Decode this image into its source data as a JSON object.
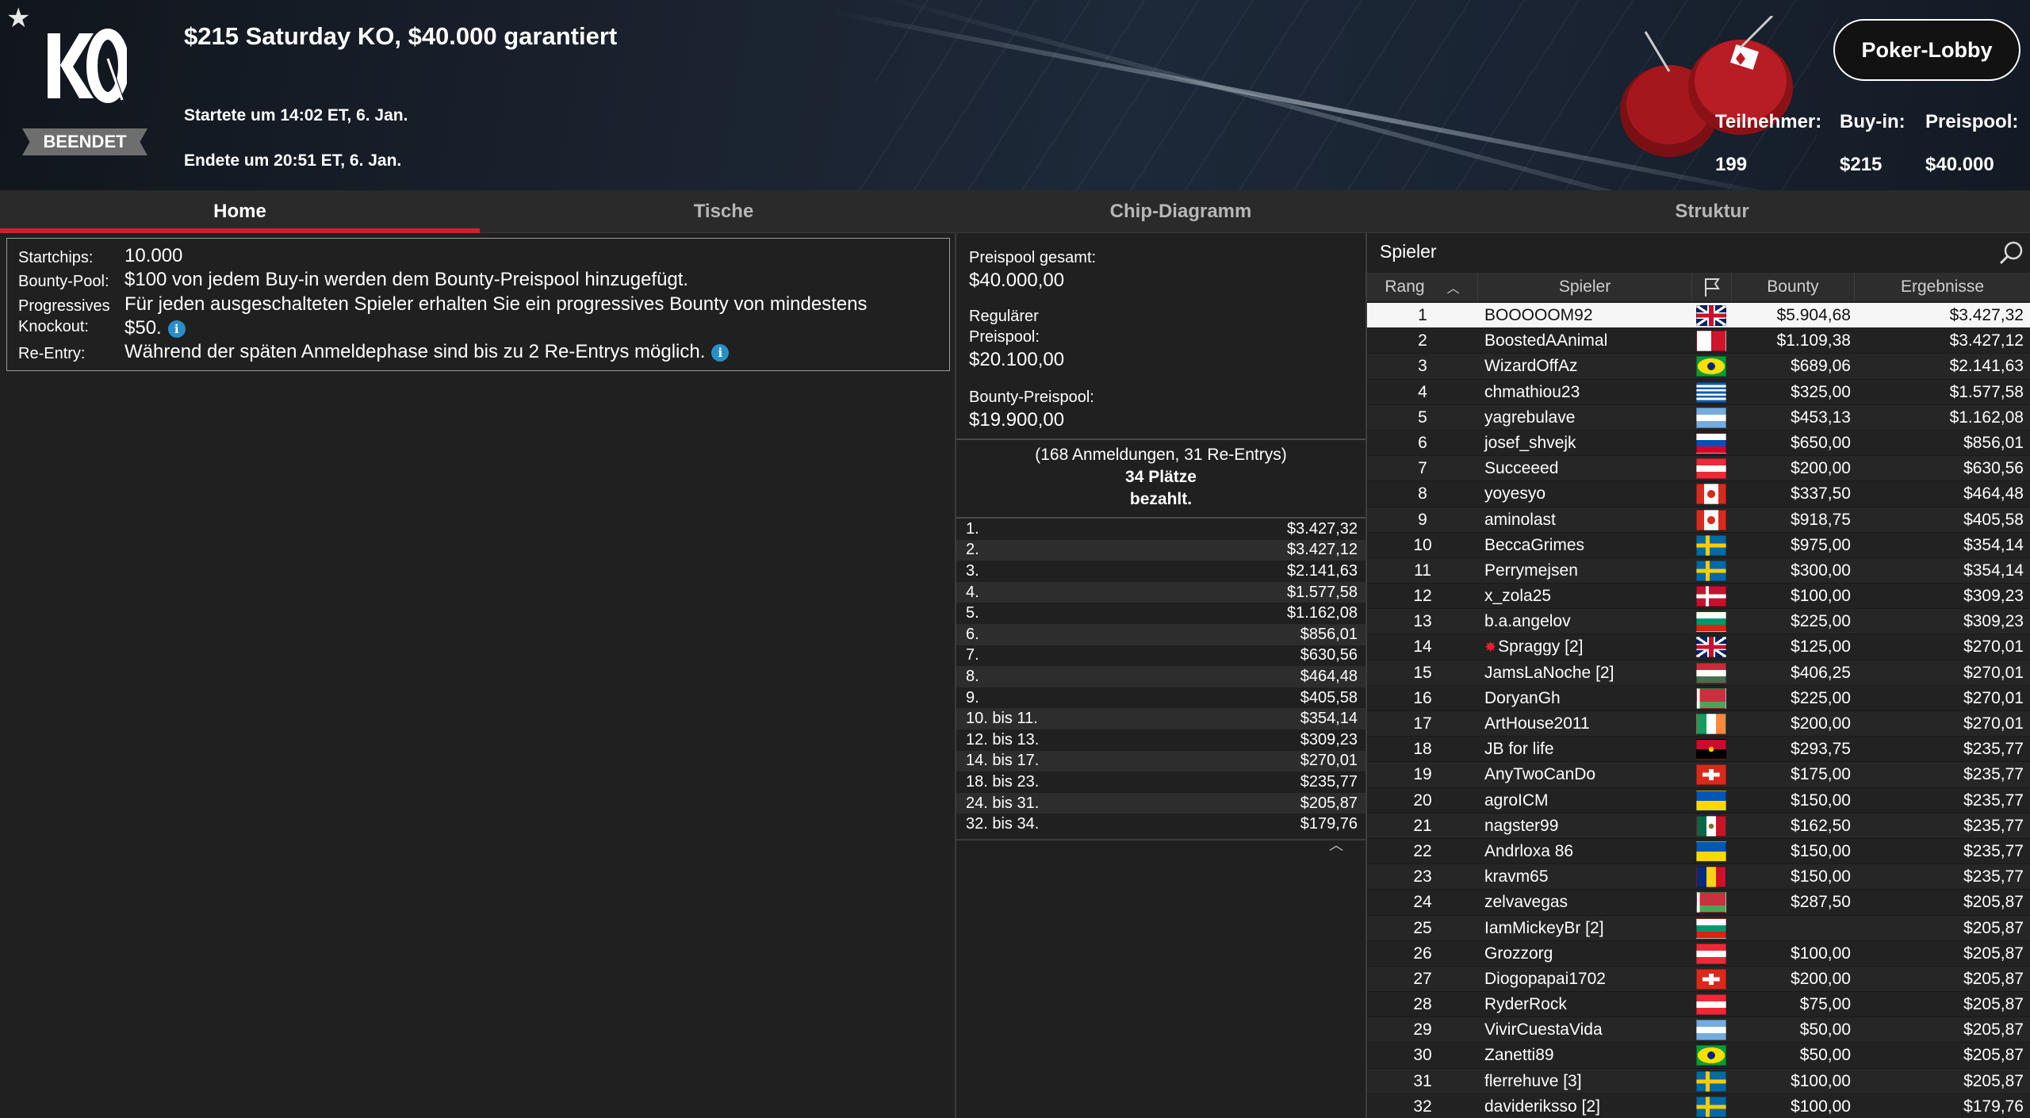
{
  "header": {
    "title": "$215 Saturday KO, $40.000 garantiert",
    "logo_text": "KO",
    "status_badge": "BEENDET",
    "started": "Startete um 14:02 ET, 6. Jan.",
    "ended": "Endete um 20:51 ET, 6. Jan.",
    "lobby_button": "Poker-Lobby",
    "stats": [
      {
        "label": "Teilnehmer:",
        "value": "199"
      },
      {
        "label": "Buy-in:",
        "value": "$215"
      },
      {
        "label": "Preispool:",
        "value": "$40.000"
      }
    ]
  },
  "tabs": [
    {
      "label": "Home",
      "active": true
    },
    {
      "label": "Tische",
      "active": false
    },
    {
      "label": "Chip-Diagramm",
      "active": false
    },
    {
      "label": "Struktur",
      "active": false
    }
  ],
  "details": {
    "startchips_label": "Startchips:",
    "startchips": "10.000",
    "bounty_pool_label": "Bounty-Pool:",
    "bounty_pool": "$100 von jedem Buy-in werden dem Bounty-Preispool hinzugefügt.",
    "progressive_label_1": "Progressives",
    "progressive_label_2": "Knockout:",
    "progressive_line1": "Für jeden ausgeschalteten Spieler erhalten Sie ein progressives Bounty von mindestens",
    "progressive_line2": "$50.",
    "reentry_label": "Re-Entry:",
    "reentry": "Während der späten Anmeldephase sind bis zu 2 Re-Entrys möglich."
  },
  "prizepool": {
    "total_label": "Preispool gesamt:",
    "total": "$40.000,00",
    "regular_label_1": "Regulärer",
    "regular_label_2": "Preispool:",
    "regular": "$20.100,00",
    "bounty_label": "Bounty-Preispool:",
    "bounty": "$19.900,00",
    "entries": "(168 Anmeldungen, 31 Re-Entrys)",
    "paid_1": "34 Plätze",
    "paid_2": "bezahlt.",
    "payouts": [
      {
        "place": "1.",
        "amount": "$3.427,32"
      },
      {
        "place": "2.",
        "amount": "$3.427,12"
      },
      {
        "place": "3.",
        "amount": "$2.141,63"
      },
      {
        "place": "4.",
        "amount": "$1.577,58"
      },
      {
        "place": "5.",
        "amount": "$1.162,08"
      },
      {
        "place": "6.",
        "amount": "$856,01"
      },
      {
        "place": "7.",
        "amount": "$630,56"
      },
      {
        "place": "8.",
        "amount": "$464,48"
      },
      {
        "place": "9.",
        "amount": "$405,58"
      },
      {
        "place": "10. bis 11.",
        "amount": "$354,14"
      },
      {
        "place": "12. bis 13.",
        "amount": "$309,23"
      },
      {
        "place": "14. bis 17.",
        "amount": "$270,01"
      },
      {
        "place": "18. bis 23.",
        "amount": "$235,77"
      },
      {
        "place": "24. bis 31.",
        "amount": "$205,87"
      },
      {
        "place": "32. bis 34.",
        "amount": "$179,76"
      }
    ]
  },
  "players": {
    "title": "Spieler",
    "columns": {
      "rank": "Rang",
      "player": "Spieler",
      "bounty": "Bounty",
      "result": "Ergebnisse"
    },
    "rows": [
      {
        "rank": "1",
        "name": "BOOOOOM92",
        "flag": "gb",
        "bounty": "$5.904,68",
        "result": "$3.427,32",
        "selected": true
      },
      {
        "rank": "2",
        "name": "BoostedAAnimal",
        "flag": "mt",
        "bounty": "$1.109,38",
        "result": "$3.427,12"
      },
      {
        "rank": "3",
        "name": "WizardOffAz",
        "flag": "br",
        "bounty": "$689,06",
        "result": "$2.141,63"
      },
      {
        "rank": "4",
        "name": "chmathiou23",
        "flag": "gr",
        "bounty": "$325,00",
        "result": "$1.577,58"
      },
      {
        "rank": "5",
        "name": "yagrebulave",
        "flag": "ar",
        "bounty": "$453,13",
        "result": "$1.162,08"
      },
      {
        "rank": "6",
        "name": "josef_shvejk",
        "flag": "si",
        "bounty": "$650,00",
        "result": "$856,01"
      },
      {
        "rank": "7",
        "name": "Succeeed",
        "flag": "at",
        "bounty": "$200,00",
        "result": "$630,56"
      },
      {
        "rank": "8",
        "name": "yoyesyo",
        "flag": "ca",
        "bounty": "$337,50",
        "result": "$464,48"
      },
      {
        "rank": "9",
        "name": "aminolast",
        "flag": "ca",
        "bounty": "$918,75",
        "result": "$405,58"
      },
      {
        "rank": "10",
        "name": "BeccaGrimes",
        "flag": "se",
        "bounty": "$975,00",
        "result": "$354,14"
      },
      {
        "rank": "11",
        "name": "Perrymejsen",
        "flag": "se",
        "bounty": "$300,00",
        "result": "$354,14"
      },
      {
        "rank": "12",
        "name": "x_zola25",
        "flag": "dk",
        "bounty": "$100,00",
        "result": "$309,23"
      },
      {
        "rank": "13",
        "name": "b.a.angelov",
        "flag": "bg",
        "bounty": "$225,00",
        "result": "$309,23"
      },
      {
        "rank": "14",
        "name": "Spraggy [2]",
        "flag": "gb",
        "bounty": "$125,00",
        "result": "$270,01",
        "star": true
      },
      {
        "rank": "15",
        "name": "JamsLaNoche [2]",
        "flag": "hu",
        "bounty": "$406,25",
        "result": "$270,01"
      },
      {
        "rank": "16",
        "name": "DoryanGh",
        "flag": "by",
        "bounty": "$225,00",
        "result": "$270,01"
      },
      {
        "rank": "17",
        "name": "ArtHouse2011",
        "flag": "ie",
        "bounty": "$200,00",
        "result": "$270,01"
      },
      {
        "rank": "18",
        "name": "JB for life",
        "flag": "ao",
        "bounty": "$293,75",
        "result": "$235,77"
      },
      {
        "rank": "19",
        "name": "AnyTwoCanDo",
        "flag": "ch",
        "bounty": "$175,00",
        "result": "$235,77"
      },
      {
        "rank": "20",
        "name": "agroICM",
        "flag": "ua",
        "bounty": "$150,00",
        "result": "$235,77"
      },
      {
        "rank": "21",
        "name": "nagster99",
        "flag": "mx",
        "bounty": "$162,50",
        "result": "$235,77"
      },
      {
        "rank": "22",
        "name": "Andrloxa 86",
        "flag": "ua",
        "bounty": "$150,00",
        "result": "$235,77"
      },
      {
        "rank": "23",
        "name": "kravm65",
        "flag": "ro",
        "bounty": "$150,00",
        "result": "$235,77"
      },
      {
        "rank": "24",
        "name": "zelvavegas",
        "flag": "by",
        "bounty": "$287,50",
        "result": "$205,87"
      },
      {
        "rank": "25",
        "name": "IamMickeyBr [2]",
        "flag": "bg",
        "bounty": "",
        "result": "$205,87"
      },
      {
        "rank": "26",
        "name": "Grozzorg",
        "flag": "at",
        "bounty": "$100,00",
        "result": "$205,87"
      },
      {
        "rank": "27",
        "name": "Diogopapai1702",
        "flag": "ch",
        "bounty": "$200,00",
        "result": "$205,87"
      },
      {
        "rank": "28",
        "name": "RyderRock",
        "flag": "at",
        "bounty": "$75,00",
        "result": "$205,87"
      },
      {
        "rank": "29",
        "name": "VivirCuestaVida",
        "flag": "ar",
        "bounty": "$50,00",
        "result": "$205,87"
      },
      {
        "rank": "30",
        "name": "Zanetti89",
        "flag": "br",
        "bounty": "$50,00",
        "result": "$205,87"
      },
      {
        "rank": "31",
        "name": "flerrehuve [3]",
        "flag": "se",
        "bounty": "$100,00",
        "result": "$205,87"
      },
      {
        "rank": "32",
        "name": "davideriksso [2]",
        "flag": "se",
        "bounty": "$100,00",
        "result": "$179,76"
      }
    ]
  }
}
